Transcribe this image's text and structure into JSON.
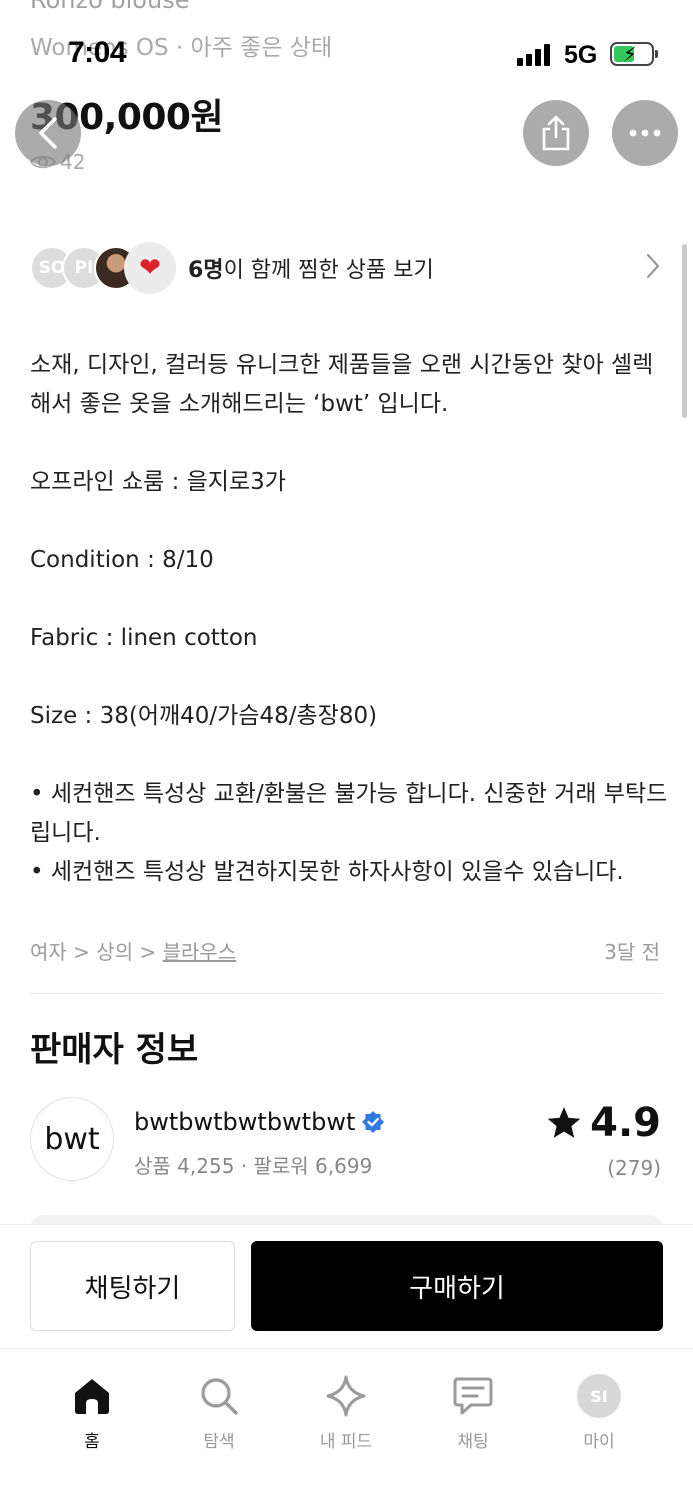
{
  "status_bar": {
    "time": "7:04",
    "network": "5G"
  },
  "product": {
    "title_partial": "Ronzo blouse",
    "meta": "Womens OS · 아주 좋은 상태",
    "price": "300,000원",
    "views": "42"
  },
  "likes": {
    "avatars": [
      "SO",
      "PI"
    ],
    "count": "6명",
    "text": "이 함께 찜한 상품 보기"
  },
  "description": [
    "소재, 디자인, 컬러등 유니크한 제품들을 오랜 시간동안 찾아 셀렉해서 좋은 옷을 소개해드리는 ‘bwt’ 입니다.",
    "",
    "오프라인 쇼룸 : 을지로3가",
    "",
    "Condition : 8/10",
    "",
    "Fabric : linen cotton",
    "",
    "Size : 38(어깨40/가슴48/총장80)",
    "",
    "• 세컨핸즈 특성상 교환/환불은 불가능 합니다. 신중한 거래 부탁드립니다.",
    "• 세컨핸즈 특성상 발견하지못한 하자사항이 있을수 있습니다."
  ],
  "category": {
    "level1": "여자",
    "sep": " > ",
    "level2": "상의",
    "level3": "블라우스"
  },
  "posted": "3달 전",
  "seller": {
    "section_title": "판매자 정보",
    "logo_text": "bwt",
    "name": "bwtbwtbwtbwtbwt",
    "stats": "상품 4,255 · 팔로워 6,699",
    "rating": "4.9",
    "reviews": "(279)"
  },
  "actions": {
    "chat": "채팅하기",
    "buy": "구매하기"
  },
  "tabs": [
    {
      "label": "홈",
      "icon": "home-icon"
    },
    {
      "label": "탐색",
      "icon": "search-icon"
    },
    {
      "label": "내 피드",
      "icon": "sparkle-icon"
    },
    {
      "label": "채팅",
      "icon": "chat-icon"
    },
    {
      "label": "마이",
      "icon": "avatar-icon",
      "avatar": "SI"
    }
  ],
  "colors": {
    "accent": "#000000",
    "verified": "#2f7be5",
    "heart": "#e0202b",
    "battery": "#34c759"
  }
}
